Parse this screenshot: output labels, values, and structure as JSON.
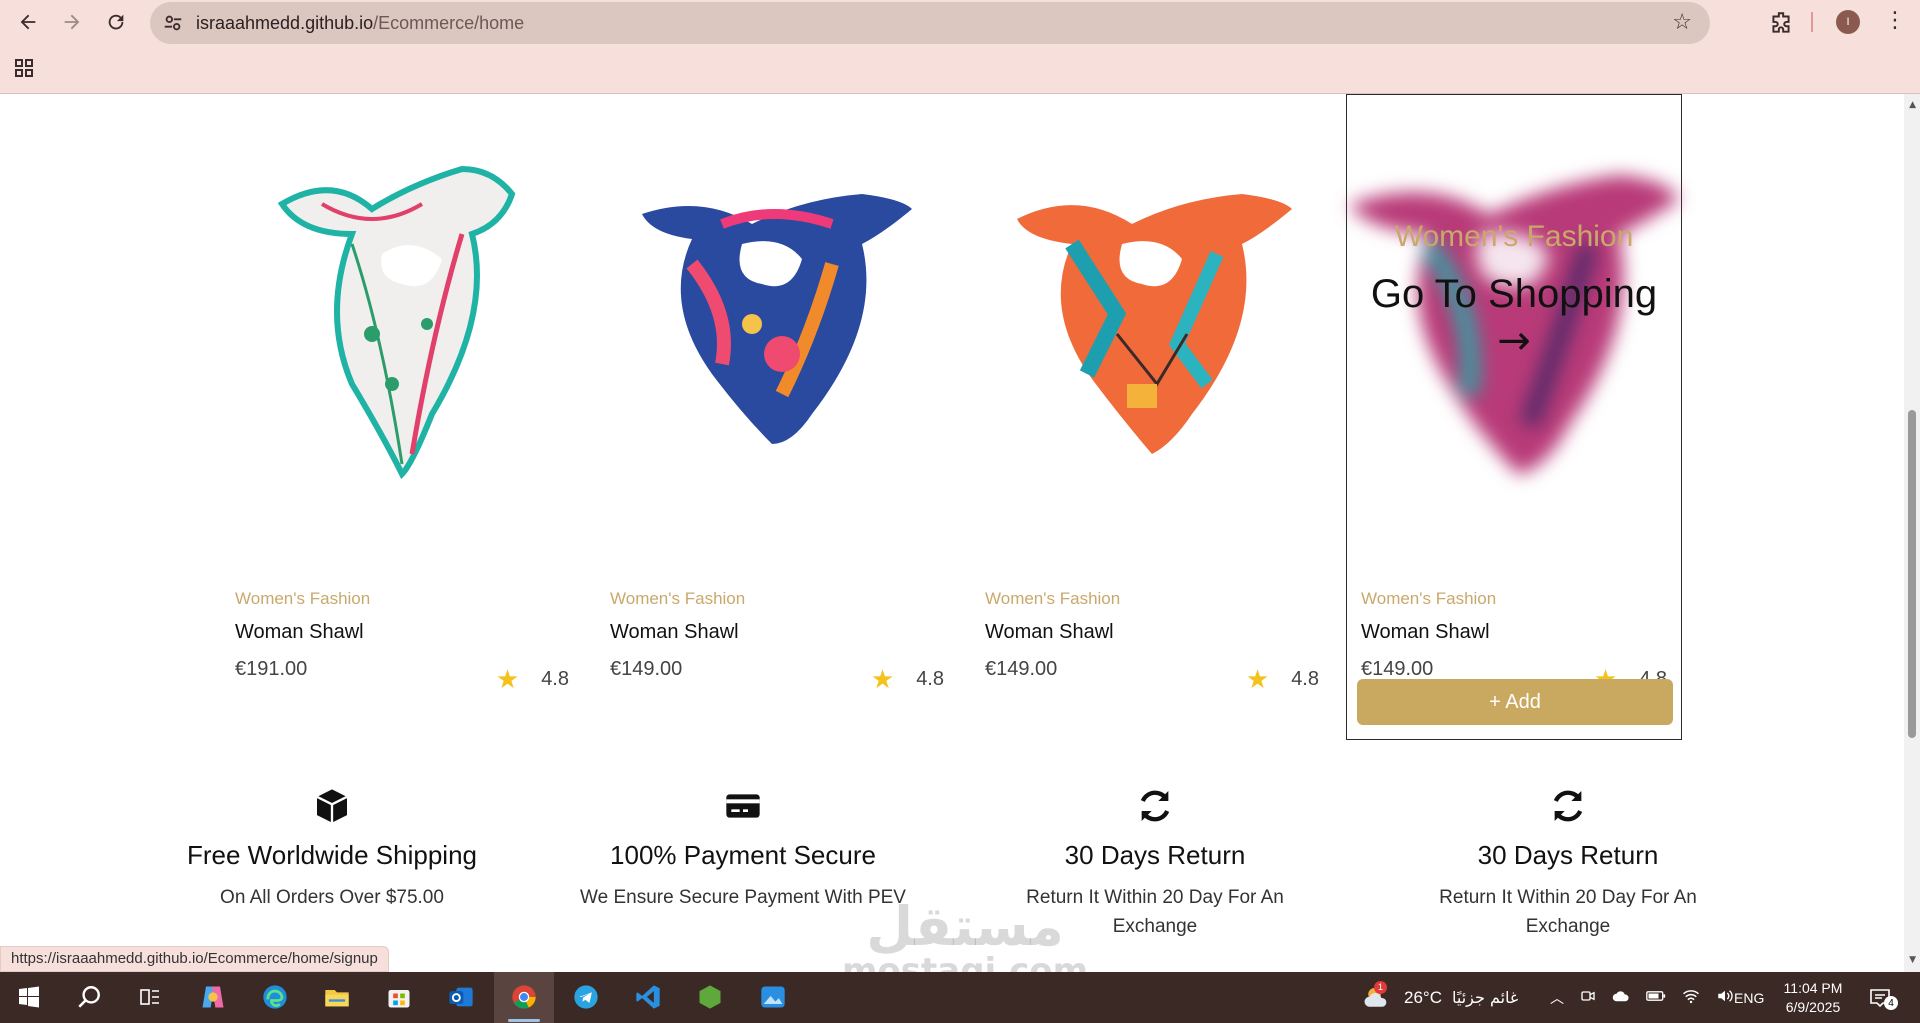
{
  "browser": {
    "url_host": "israaahmedd.github.io",
    "url_path": "/Ecommerce/home",
    "profile_initial": "I"
  },
  "products": [
    {
      "category": "Women's Fashion",
      "name": "Woman Shawl",
      "price": "€191.00",
      "rating": "4.8"
    },
    {
      "category": "Women's Fashion",
      "name": "Woman Shawl",
      "price": "€149.00",
      "rating": "4.8"
    },
    {
      "category": "Women's Fashion",
      "name": "Woman Shawl",
      "price": "€149.00",
      "rating": "4.8"
    },
    {
      "category": "Women's Fashion",
      "name": "Woman Shawl",
      "price": "€149.00",
      "rating": "4.8"
    }
  ],
  "hover_overlay": {
    "category": "Women's Fashion",
    "title": "Go To Shopping",
    "arrow": "→"
  },
  "add_button_label": "+ Add",
  "features": [
    {
      "icon": "box-icon",
      "title": "Free Worldwide Shipping",
      "subtitle": "On All Orders Over $75.00"
    },
    {
      "icon": "credit-card-icon",
      "title": "100% Payment Secure",
      "subtitle": "We Ensure Secure Payment With PEV"
    },
    {
      "icon": "refresh-icon",
      "title": "30 Days Return",
      "subtitle": "Return It Within 20 Day For An Exchange"
    },
    {
      "icon": "refresh-icon",
      "title": "30 Days Return",
      "subtitle": "Return It Within 20 Day For An Exchange"
    }
  ],
  "status_url": "https://israaahmedd.github.io/Ecommerce/home/signup",
  "watermark": {
    "arabic": "مستقل",
    "latin": "mostaqi.com"
  },
  "taskbar": {
    "weather_temp": "26°C",
    "weather_desc": "غائم جزئيًا",
    "weather_badge": "1",
    "language": "ENG",
    "time": "11:04 PM",
    "date": "6/9/2025",
    "notifications": "4"
  },
  "colors": {
    "accent_gold": "#c9a960",
    "category_gold": "#c9a96b",
    "star_yellow": "#f3c21c",
    "chrome_bg": "#f7e0dc"
  }
}
